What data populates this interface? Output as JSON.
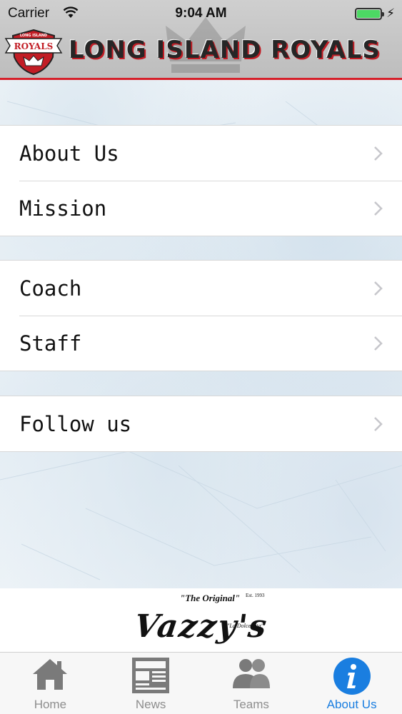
{
  "status_bar": {
    "carrier": "Carrier",
    "time": "9:04 AM"
  },
  "header": {
    "title": "LONG ISLAND ROYALS",
    "logo_text": "ROYALS",
    "logo_subtext": "LONG ISLAND",
    "accent_color": "#d6202a"
  },
  "menu": {
    "groups": [
      {
        "items": [
          {
            "label": "About Us"
          },
          {
            "label": "Mission"
          }
        ]
      },
      {
        "items": [
          {
            "label": "Coach"
          },
          {
            "label": "Staff"
          }
        ]
      },
      {
        "items": [
          {
            "label": "Follow us"
          }
        ]
      }
    ]
  },
  "sponsor": {
    "tagline": "\"The Original\"",
    "name": "Vazzy's",
    "est": "Est. 1993",
    "sub": "\"La Dolce Vita\""
  },
  "tabbar": {
    "active_color": "#1a7ee0",
    "tabs": [
      {
        "label": "Home",
        "icon": "home-icon"
      },
      {
        "label": "News",
        "icon": "news-icon"
      },
      {
        "label": "Teams",
        "icon": "teams-icon"
      },
      {
        "label": "About Us",
        "icon": "info-icon",
        "active": true
      }
    ]
  }
}
